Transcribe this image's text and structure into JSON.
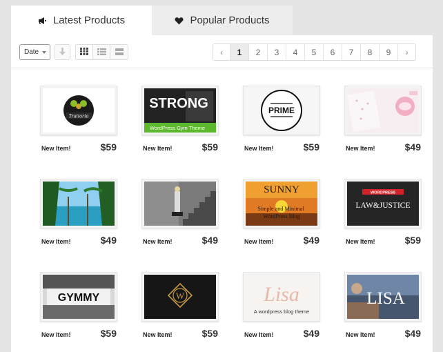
{
  "tabs": [
    {
      "label": "Latest Products",
      "icon": "megaphone-icon",
      "active": true
    },
    {
      "label": "Popular Products",
      "icon": "heart-icon",
      "active": false
    }
  ],
  "toolbar": {
    "sort_select": "Date",
    "sort_direction_icon": "arrow-down-icon",
    "view_modes": [
      "grid-view-icon",
      "list-view-icon",
      "compact-view-icon"
    ]
  },
  "pagination": {
    "prev": "‹",
    "pages": [
      "1",
      "2",
      "3",
      "4",
      "5",
      "6",
      "7",
      "8",
      "9"
    ],
    "current": "1",
    "next": "›"
  },
  "products": [
    {
      "label": "New Item!",
      "price": "$59",
      "thumb_text": "Trattoria",
      "thumb_subtext": ""
    },
    {
      "label": "New Item!",
      "price": "$59",
      "thumb_text": "STRONG",
      "thumb_subtext": "WordPress Gym Theme"
    },
    {
      "label": "New Item!",
      "price": "$59",
      "thumb_text": "PRIME",
      "thumb_subtext": ""
    },
    {
      "label": "New Item!",
      "price": "$49",
      "thumb_text": "",
      "thumb_subtext": ""
    },
    {
      "label": "New Item!",
      "price": "$49",
      "thumb_text": "",
      "thumb_subtext": ""
    },
    {
      "label": "New Item!",
      "price": "$49",
      "thumb_text": "",
      "thumb_subtext": ""
    },
    {
      "label": "New Item!",
      "price": "$49",
      "thumb_text": "SUNNY",
      "thumb_subtext": "Simple and Minimal WordPress Blog"
    },
    {
      "label": "New Item!",
      "price": "$59",
      "thumb_text": "LAW&JUSTICE",
      "thumb_subtext": "WORDPRESS"
    },
    {
      "label": "New Item!",
      "price": "$59",
      "thumb_text": "GYMMY",
      "thumb_subtext": ""
    },
    {
      "label": "New Item!",
      "price": "$59",
      "thumb_text": "W",
      "thumb_subtext": ""
    },
    {
      "label": "New Item!",
      "price": "$49",
      "thumb_text": "Lisa",
      "thumb_subtext": "A wordpress blog theme"
    },
    {
      "label": "New Item!",
      "price": "$49",
      "thumb_text": "LISA",
      "thumb_subtext": ""
    }
  ]
}
